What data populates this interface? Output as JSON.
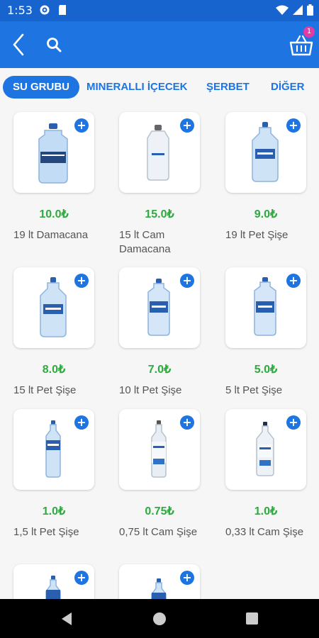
{
  "status_bar": {
    "time": "1:53"
  },
  "header": {
    "back_icon": "chevron-left-icon",
    "search_icon": "search-icon",
    "cart_icon": "basket-icon",
    "cart_count": "1"
  },
  "tabs": [
    {
      "label": "SU GRUBU",
      "active": true
    },
    {
      "label": "MINERALLI İÇECEK",
      "active": false
    },
    {
      "label": "ŞERBET",
      "active": false
    },
    {
      "label": "DİĞER",
      "active": false
    }
  ],
  "products": [
    {
      "price": "10.0₺",
      "name": "19 lt Damacana",
      "kind": "demijohn"
    },
    {
      "price": "15.0₺",
      "name": "15 lt Cam Damacana",
      "kind": "glass-jug"
    },
    {
      "price": "9.0₺",
      "name": "19 lt Pet Şişe",
      "kind": "big-pet"
    },
    {
      "price": "8.0₺",
      "name": "15 lt Pet Şişe",
      "kind": "big-pet"
    },
    {
      "price": "7.0₺",
      "name": "10 lt Pet Şişe",
      "kind": "mid-pet"
    },
    {
      "price": "5.0₺",
      "name": "5 lt Pet Şişe",
      "kind": "mid-pet"
    },
    {
      "price": "1.0₺",
      "name": "1,5 lt Pet Şişe",
      "kind": "slim-pet"
    },
    {
      "price": "0.75₺",
      "name": "0,75 lt Cam Şişe",
      "kind": "glass-bottle"
    },
    {
      "price": "1.0₺",
      "name": "0,33 lt Cam Şişe",
      "kind": "small-glass"
    },
    {
      "price": "",
      "name": "",
      "kind": "slim-pet"
    },
    {
      "price": "",
      "name": "",
      "kind": "slim-pet"
    }
  ],
  "colors": {
    "primary": "#1e74e0",
    "status_bar": "#1764cf",
    "price": "#2eaa3f",
    "badge": "#e33aa6"
  }
}
